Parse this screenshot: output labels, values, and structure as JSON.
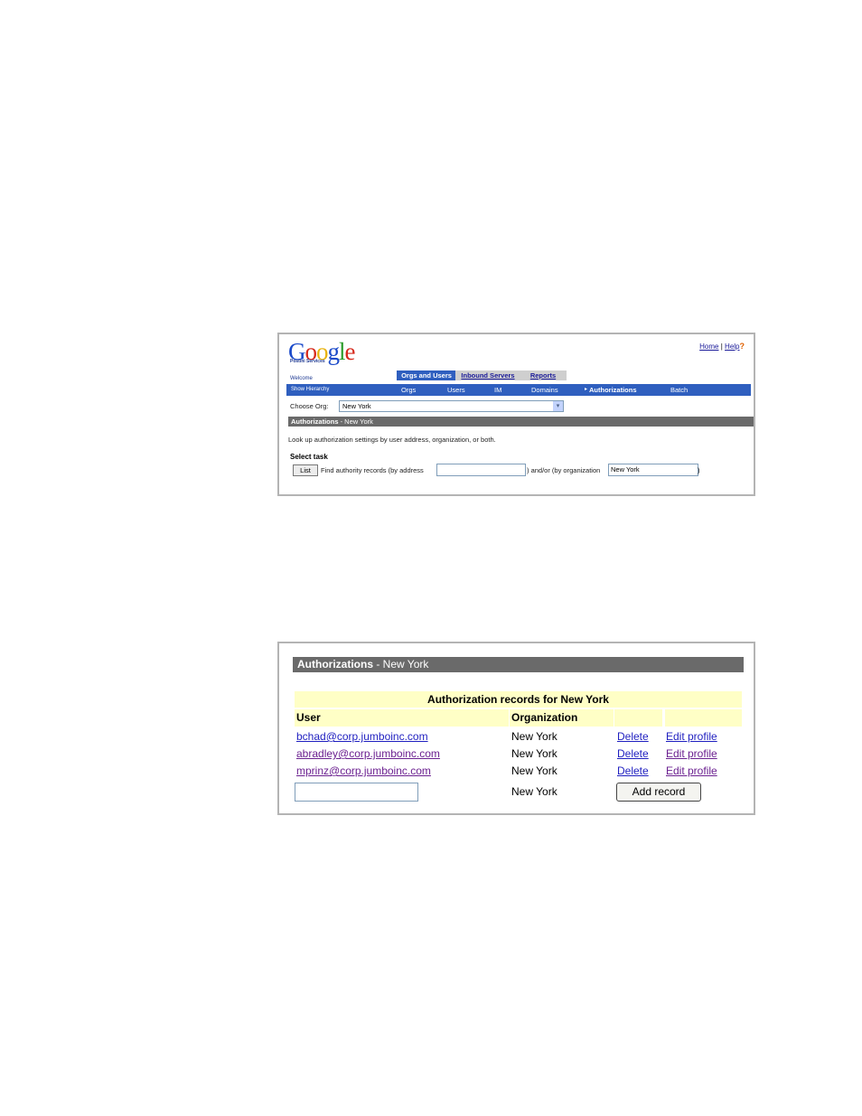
{
  "screen1": {
    "logo": {
      "letters": [
        {
          "char": "G",
          "color": "#1a49c9"
        },
        {
          "char": "o",
          "color": "#d6291c"
        },
        {
          "char": "o",
          "color": "#e8b310"
        },
        {
          "char": "g",
          "color": "#1a49c9"
        },
        {
          "char": "l",
          "color": "#2a9b2a"
        },
        {
          "char": "e",
          "color": "#d6291c"
        }
      ],
      "subtitle": "Postini Services"
    },
    "top_links": {
      "home": "Home",
      "separator": "|",
      "help": "Help",
      "help_icon": "?"
    },
    "welcome": "Welcome",
    "tabs": {
      "orgs": "Orgs and Users",
      "inbound": "Inbound Servers",
      "reports": "Reports"
    },
    "nav": {
      "show_hierarchy": "Show Hierarchy",
      "items": [
        "Orgs",
        "Users",
        "IM",
        "Domains",
        "Authorizations",
        "Batch"
      ],
      "selected_marker": "▸"
    },
    "choose_org": {
      "label": "Choose Org:",
      "value": "New York",
      "arrow": "▾"
    },
    "section": {
      "title": "Authorizations",
      "separator": " - ",
      "org": "New York"
    },
    "description": "Look up authorization settings by user address, organization, or both.",
    "select_task": "Select task",
    "task": {
      "button": "List",
      "find_label": "Find authority records (by address",
      "andor_label": ") and/or (by organization",
      "org_value": "New York",
      "close_paren": ")"
    }
  },
  "screen2": {
    "section": {
      "title": "Authorizations",
      "separator": " - ",
      "org": "New York"
    },
    "table_title": "Authorization records for New York",
    "columns": {
      "user": "User",
      "organization": "Organization"
    },
    "rows": [
      {
        "user": "bchad@corp.jumboinc.com",
        "org": "New York",
        "delete": "Delete",
        "edit": "Edit profile",
        "visited": false
      },
      {
        "user": "abradley@corp.jumboinc.com",
        "org": "New York",
        "delete": "Delete",
        "edit": "Edit profile",
        "visited": true
      },
      {
        "user": "mprinz@corp.jumboinc.com",
        "org": "New York",
        "delete": "Delete",
        "edit": "Edit profile",
        "visited": true
      }
    ],
    "new_row": {
      "org": "New York",
      "button": "Add record"
    }
  }
}
